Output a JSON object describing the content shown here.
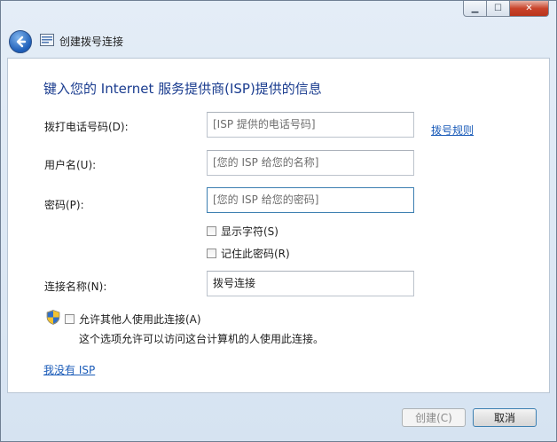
{
  "window": {
    "title": "创建拨号连接"
  },
  "heading": "键入您的 Internet 服务提供商(ISP)提供的信息",
  "form": {
    "phone": {
      "label": "拨打电话号码(D):",
      "placeholder": "[ISP 提供的电话号码]"
    },
    "dial_rules_link": "拨号规则",
    "username": {
      "label": "用户名(U):",
      "placeholder": "[您的 ISP 给您的名称]"
    },
    "password": {
      "label": "密码(P):",
      "placeholder": "[您的 ISP 给您的密码]"
    },
    "show_chars": {
      "label": "显示字符(S)",
      "checked": false
    },
    "remember_password": {
      "label": "记住此密码(R)",
      "checked": false
    },
    "connection_name": {
      "label": "连接名称(N):",
      "value": "拨号连接"
    },
    "allow_others": {
      "label": "允许其他人使用此连接(A)",
      "checked": false,
      "note": "这个选项允许可以访问这台计算机的人使用此连接。"
    }
  },
  "no_isp_link": "我没有 ISP",
  "buttons": {
    "create": "创建(C)",
    "cancel": "取消"
  },
  "icons": {
    "back": "back-arrow-icon",
    "title": "network-connection-icon",
    "shield": "uac-shield-icon",
    "minimize": "minimize-icon",
    "maximize": "maximize-icon",
    "close": "close-icon"
  },
  "colors": {
    "heading": "#1a3c8f",
    "link": "#1a5bb8",
    "focus_border": "#3c7fb1",
    "close": "#c9442b"
  }
}
